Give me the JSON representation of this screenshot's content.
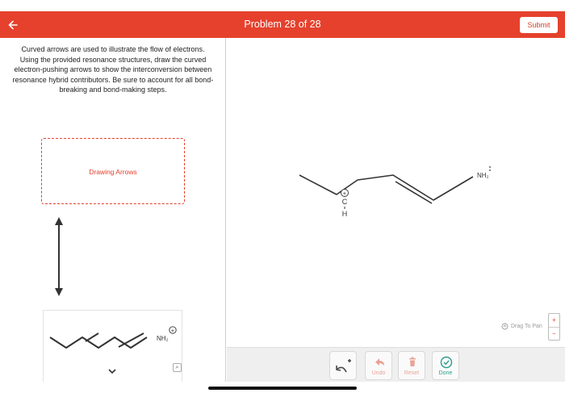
{
  "header": {
    "title": "Problem 28 of 28",
    "submit_label": "Submit"
  },
  "instructions": {
    "text": "Curved arrows are used to illustrate the flow of electrons. Using the provided resonance structures, draw the curved electron-pushing arrows to show the interconversion between resonance hybrid contributors. Be sure to account for all bond-breaking and bond-making steps."
  },
  "drop_zone": {
    "label": "Drawing Arrows"
  },
  "product_structure": {
    "group_label": "NH₂",
    "charge": "+"
  },
  "canvas_structure": {
    "carbon_label": "C",
    "hydrogen_label": "H",
    "group_label": "NH₂",
    "charge": "+"
  },
  "canvas": {
    "drag_to_pan_label": "Drag To Pan"
  },
  "toolbar": {
    "undo_label": "Undo",
    "reset_label": "Reset",
    "done_label": "Done"
  },
  "colors": {
    "brand": "#e5412d",
    "done": "#2e9c8e",
    "disabled": "#e8a397"
  },
  "icons": [
    "back-arrow-icon",
    "curved-arrow-add-icon",
    "undo-icon",
    "trash-icon",
    "check-circle-icon",
    "hand-icon",
    "chevron-down-icon",
    "zoom-icon"
  ]
}
